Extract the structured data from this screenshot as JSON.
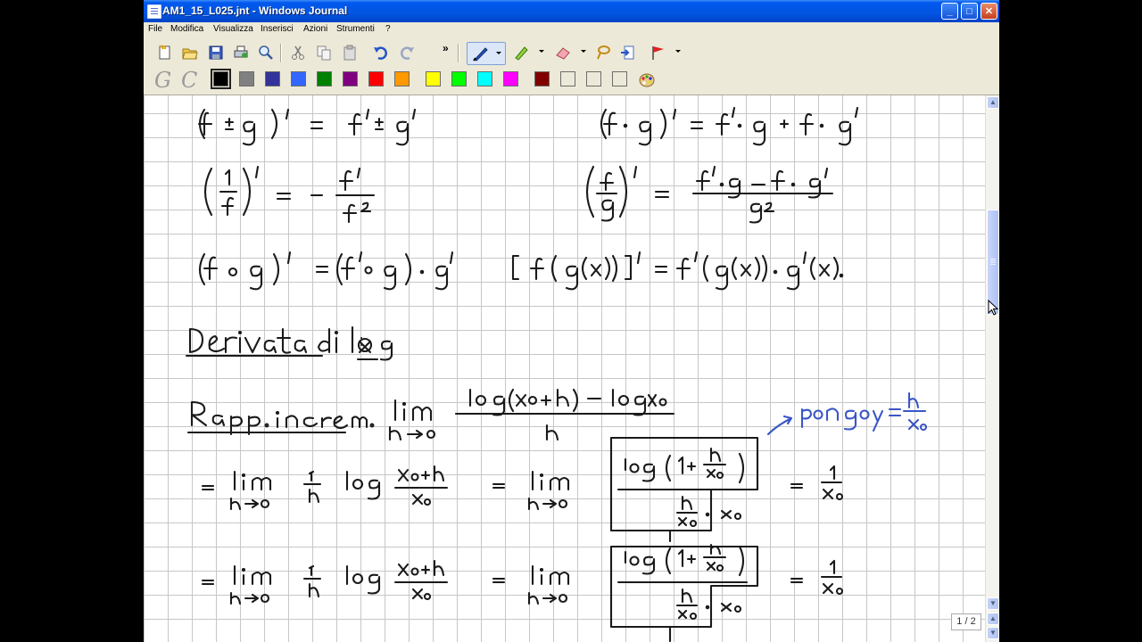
{
  "window": {
    "title": "AM1_15_L025.jnt - Windows Journal"
  },
  "caption_buttons": {
    "minimize": "_",
    "maximize": "□",
    "close": "✕"
  },
  "menu": {
    "items": [
      "File",
      "Modifica",
      "Visualizza",
      "Inserisci",
      "Azioni",
      "Strumenti",
      "?"
    ]
  },
  "toolbar1": {
    "buttons": [
      "new-note-icon",
      "open-icon",
      "save-icon",
      "print-icon",
      "find-icon",
      "cut-icon",
      "copy-icon",
      "paste-icon",
      "undo-icon",
      "redo-icon",
      "more-icon",
      "pen-icon",
      "highlighter-icon",
      "eraser-icon",
      "lasso-icon",
      "insert-space-icon",
      "flag-icon"
    ],
    "more_label": "»"
  },
  "toolbar2": {
    "gc_labels": [
      "G",
      "C"
    ],
    "palette_colors": [
      "#000000",
      "#808080",
      "#333399",
      "#3366ff",
      "#008000",
      "#800080",
      "#ff0000",
      "#ff9900",
      "#ffff00",
      "#00ff00",
      "#00ffff",
      "#ff00ff",
      "#800000",
      "#ece9d8",
      "#ece9d8",
      "#ece9d8"
    ],
    "selected_color": "#000000"
  },
  "note": {
    "heading": "Derivata di log x",
    "subheading": "Rapp. increm.",
    "annotation": "pongo y = h/x₀",
    "ink_color": "#1a1a1a",
    "accent_color": "#3a56c5"
  },
  "status": {
    "page_indicator": "1 / 2"
  }
}
